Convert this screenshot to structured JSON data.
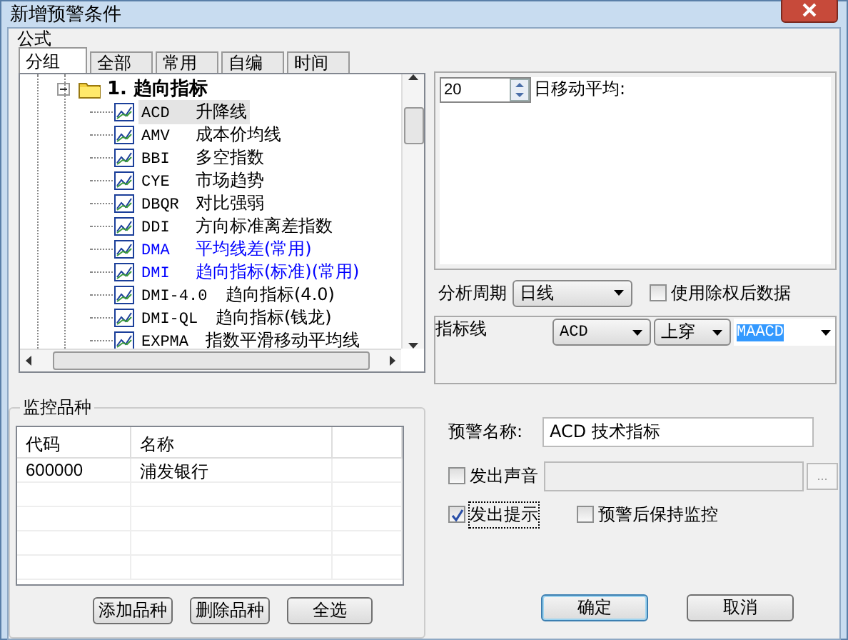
{
  "window": {
    "title": "新增预警条件"
  },
  "formula": {
    "label": "公式",
    "tabs": [
      {
        "label": "分组",
        "selected": true
      },
      {
        "label": "全部",
        "selected": false
      },
      {
        "label": "常用",
        "selected": false
      },
      {
        "label": "自编",
        "selected": false
      },
      {
        "label": "时间",
        "selected": false
      }
    ],
    "tree": [
      {
        "label": "1. 趋向指标",
        "expanded": true,
        "children": [
          {
            "code": "ACD",
            "name": "升降线",
            "selected": true,
            "color": "#000000"
          },
          {
            "code": "AMV",
            "name": "成本价均线",
            "selected": false,
            "color": "#000000"
          },
          {
            "code": "BBI",
            "name": "多空指数",
            "selected": false,
            "color": "#000000"
          },
          {
            "code": "CYE",
            "name": "市场趋势",
            "selected": false,
            "color": "#000000"
          },
          {
            "code": "DBQR",
            "name": "对比强弱",
            "selected": false,
            "color": "#000000"
          },
          {
            "code": "DDI",
            "name": "方向标准离差指数",
            "selected": false,
            "color": "#000000"
          },
          {
            "code": "DMA",
            "name": "平均线差(常用)",
            "selected": false,
            "color": "#0000ff"
          },
          {
            "code": "DMI",
            "name": "趋向指标(标准)(常用)",
            "selected": false,
            "color": "#0000ff"
          },
          {
            "code": "DMI-4.0",
            "name": "趋向指标(4.0)",
            "selected": false,
            "color": "#000000"
          },
          {
            "code": "DMI-QL",
            "name": "趋向指标(钱龙)",
            "selected": false,
            "color": "#000000"
          },
          {
            "code": "EXPMA",
            "name": "指数平滑移动平均线",
            "selected": false,
            "color": "#000000"
          }
        ]
      }
    ]
  },
  "params": {
    "spin_value": "20",
    "spin_label": "日移动平均:"
  },
  "period": {
    "label": "分析周期",
    "value": "日线"
  },
  "adjusted": {
    "label": "使用除权后数据",
    "checked": false
  },
  "indicator": {
    "label": "指标线",
    "line": "ACD",
    "cross": "上穿",
    "target": "MAACD",
    "target_highlighted": true
  },
  "watchlist": {
    "label": "监控品种",
    "columns": [
      "代码",
      "名称"
    ],
    "rows": [
      [
        "600000",
        "浦发银行"
      ]
    ],
    "buttons": [
      "添加品种",
      "删除品种",
      "全选"
    ]
  },
  "alert": {
    "name_label": "预警名称:",
    "name_value": "ACD 技术指标",
    "options": [
      {
        "kind": "sound",
        "label": "发出声音",
        "checked": false,
        "browse": "..."
      },
      {
        "kind": "plain",
        "label": "发出提示",
        "checked": true,
        "focused": true
      },
      {
        "kind": "plain",
        "label": "预警后保持监控",
        "checked": false,
        "focused": false
      }
    ]
  },
  "buttons": [
    {
      "label": "确定",
      "default": true
    },
    {
      "label": "取消",
      "default": false
    }
  ]
}
